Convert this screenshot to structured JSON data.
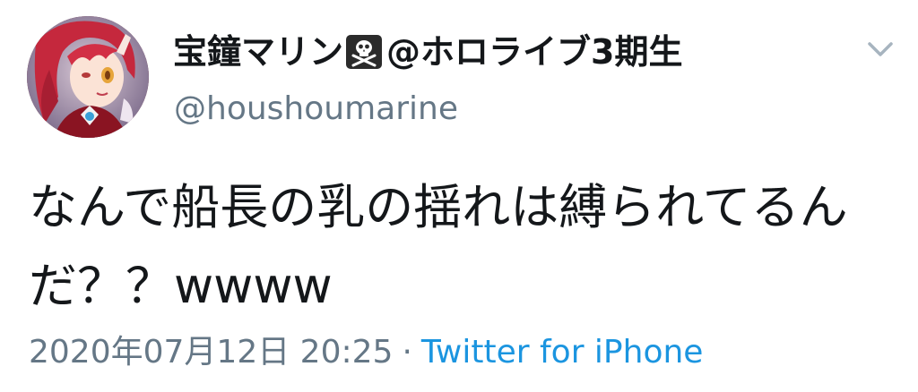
{
  "tweet": {
    "display_name": "宝鐘マリン",
    "name_suffix": "@ホロライブ3期生",
    "handle": "@houshoumarine",
    "text": "なんで船長の乳の揺れは縛られてるんだ？？wwww",
    "timestamp": "2020年07月12日 20:25",
    "separator": "·",
    "source": "Twitter for iPhone"
  },
  "icons": {
    "name_emoji": "skull-and-crossbones-icon",
    "menu": "chevron-down-icon"
  },
  "colors": {
    "text": "#14171a",
    "secondary": "#657786",
    "link": "#1b95e0"
  }
}
